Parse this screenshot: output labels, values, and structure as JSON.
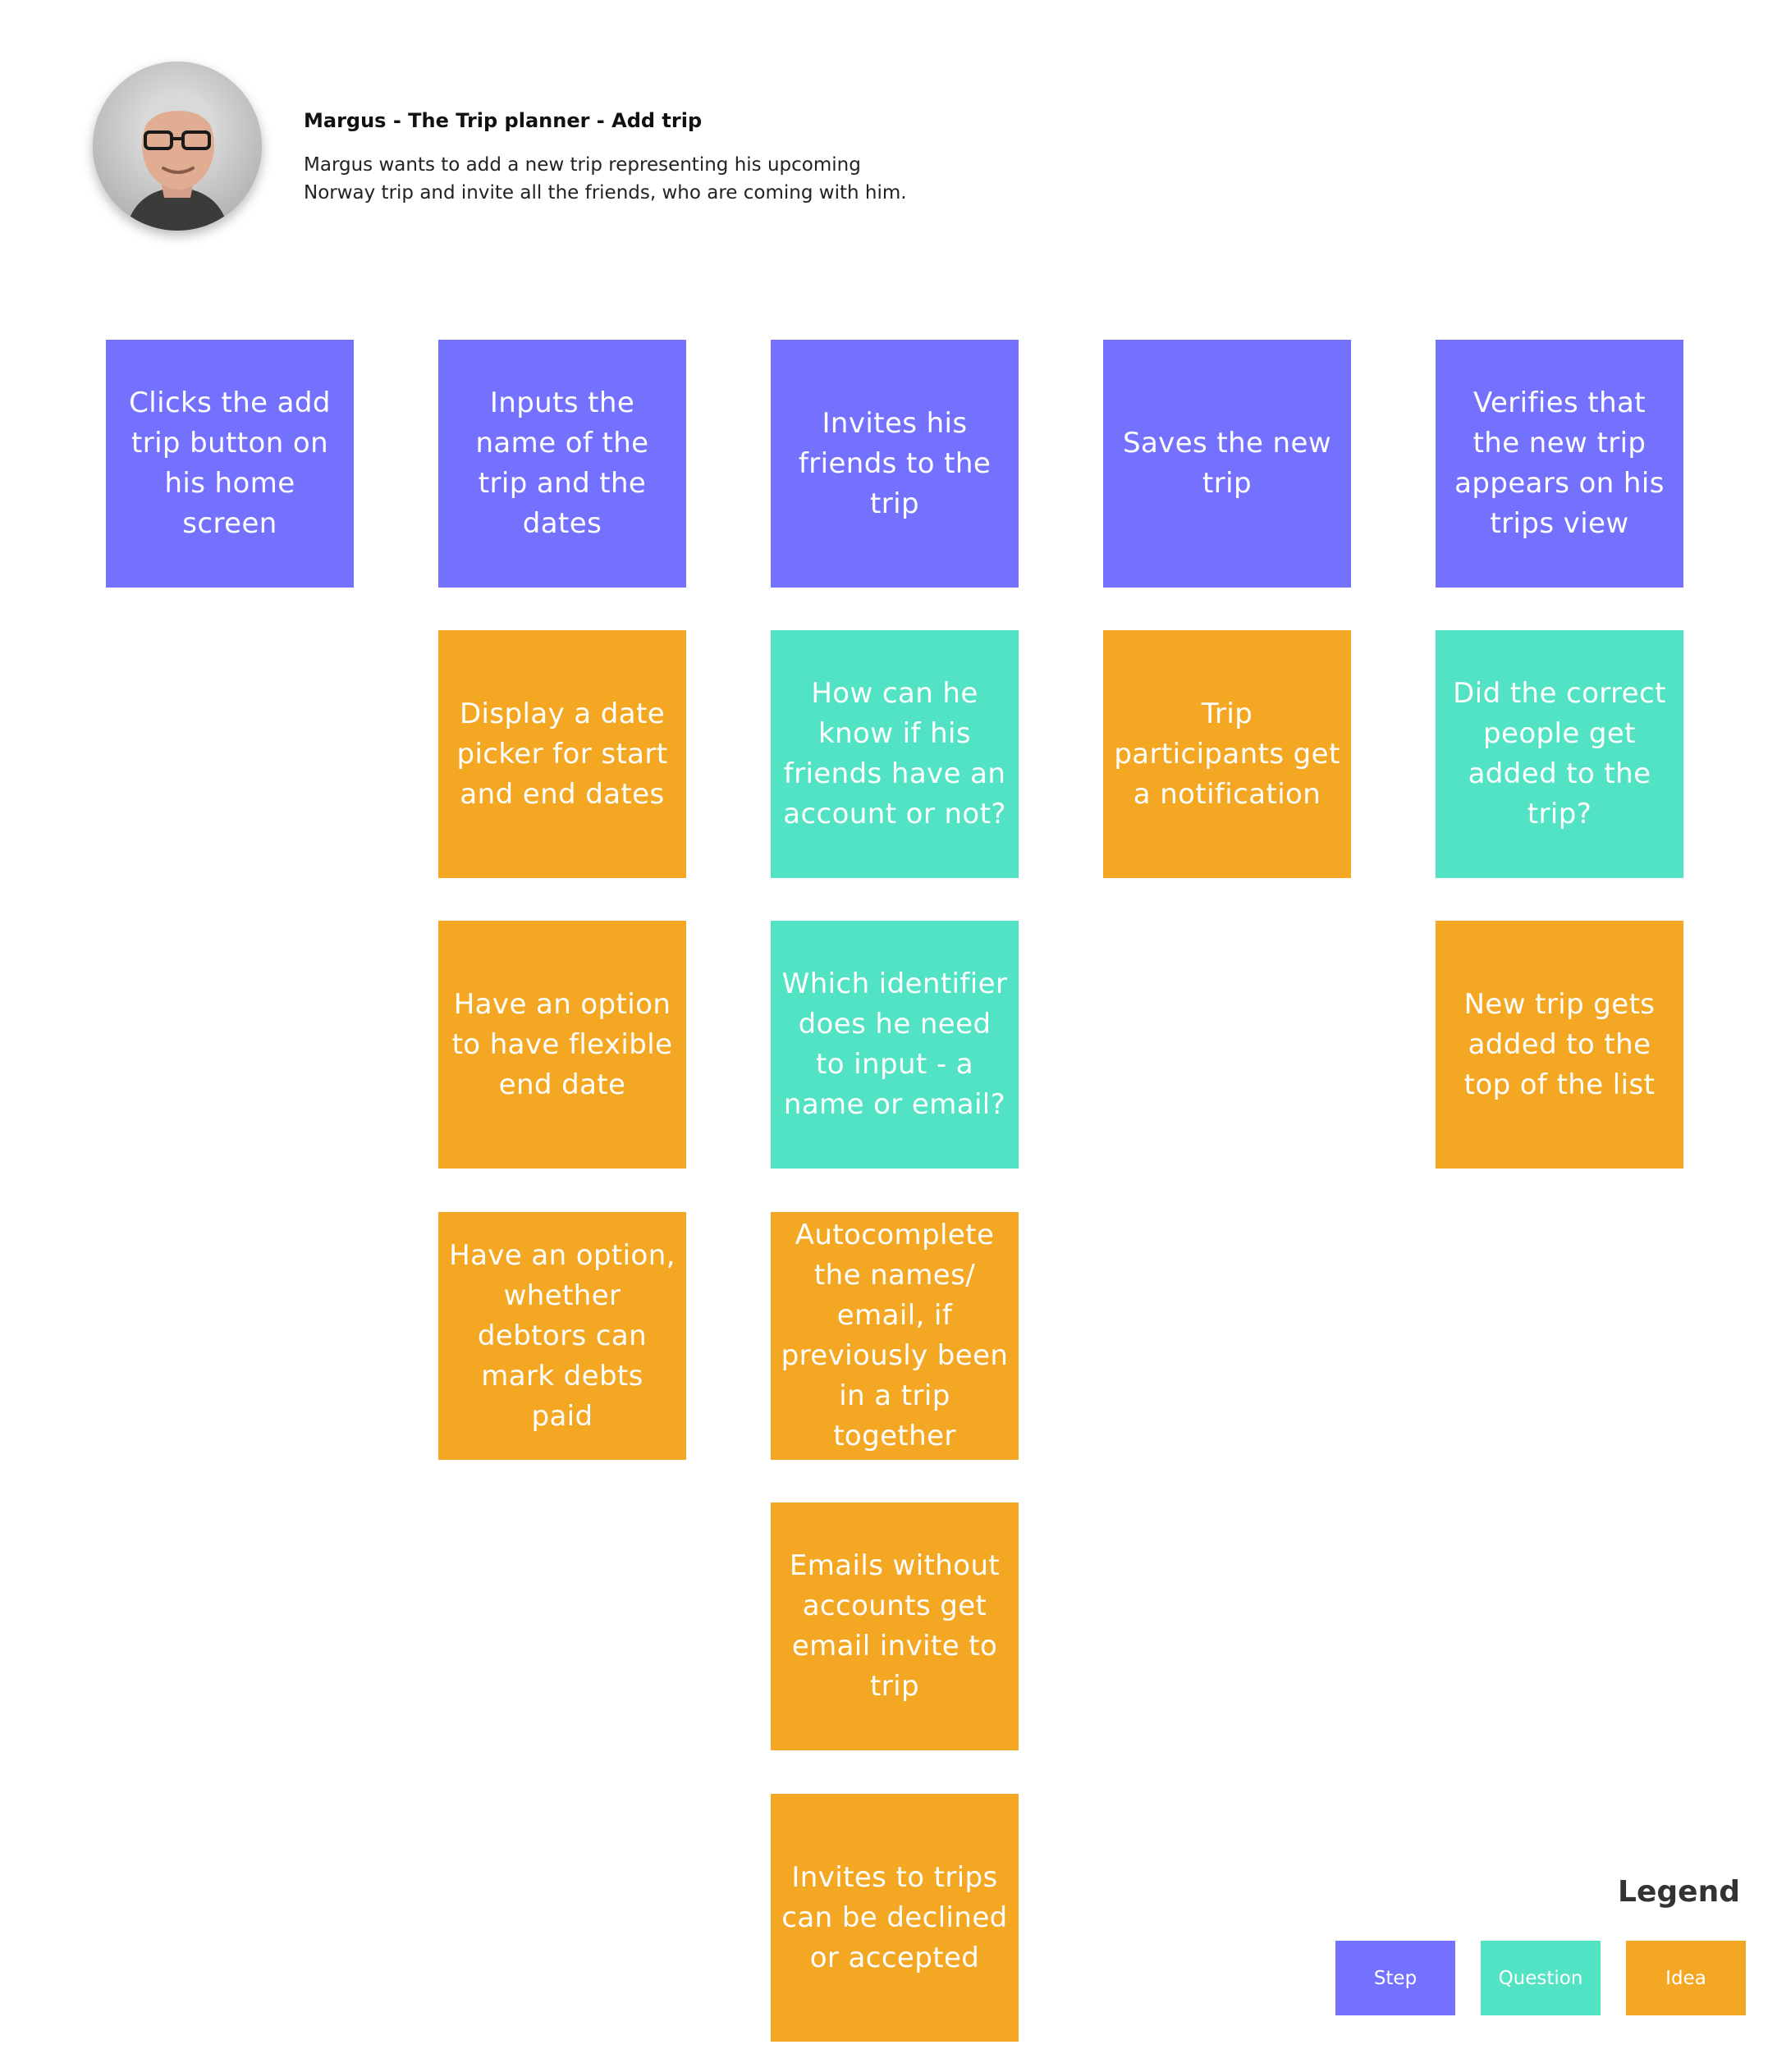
{
  "header": {
    "title": "Margus - The Trip planner - Add trip",
    "description_lines": [
      "Margus wants to add a new trip representing his upcoming",
      "Norway trip and invite all the friends, who are coming with him."
    ]
  },
  "colors": {
    "step": "#7471fe",
    "question": "#51e3c3",
    "idea": "#f4a723"
  },
  "columns": [
    {
      "step": "Clicks the add trip button on his home screen",
      "notes": []
    },
    {
      "step": "Inputs the name of the trip and the dates",
      "notes": [
        {
          "type": "idea",
          "text": "Display a date picker for start and end dates"
        },
        {
          "type": "idea",
          "text": "Have an option to have flexible end date"
        },
        {
          "type": "idea",
          "text": "Have an option, whether debtors can mark debts paid"
        }
      ]
    },
    {
      "step": "Invites his friends to the trip",
      "notes": [
        {
          "type": "question",
          "text": "How can he know if his friends have an account or not?"
        },
        {
          "type": "question",
          "text": "Which identifier does he need to input - a name or email?"
        },
        {
          "type": "idea",
          "text": "Autocomplete the names/ email, if previously been in a trip together"
        },
        {
          "type": "idea",
          "text": "Emails without accounts get email invite to trip"
        },
        {
          "type": "idea",
          "text": "Invites to trips can be declined or accepted"
        }
      ]
    },
    {
      "step": "Saves the new trip",
      "notes": [
        {
          "type": "idea",
          "text": "Trip participants get a notification"
        }
      ]
    },
    {
      "step": "Verifies that the new trip appears on his trips view",
      "notes": [
        {
          "type": "question",
          "text": "Did the correct people get added to the trip?"
        },
        {
          "type": "idea",
          "text": "New trip gets added to the top of the list"
        }
      ]
    }
  ],
  "legend": {
    "title": "Legend",
    "step": "Step",
    "question": "Question",
    "idea": "Idea"
  }
}
